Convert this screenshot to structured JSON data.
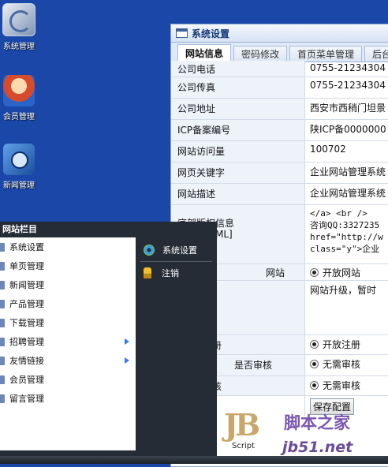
{
  "desktop": {
    "icons": [
      {
        "label": "系统管理"
      },
      {
        "label": "会员管理"
      },
      {
        "label": "新闻管理"
      }
    ]
  },
  "window": {
    "title": "系统设置",
    "tabs": [
      "网站信息",
      "密码修改",
      "首页菜单管理",
      "后台"
    ],
    "fields": [
      {
        "label": "公司电话",
        "value": "0755-21234304"
      },
      {
        "label": "公司传真",
        "value": "0755-21234304"
      },
      {
        "label": "公司地址",
        "value": "西安市西稍门坦景"
      },
      {
        "label": "ICP备案编号",
        "value": "陕ICP备0000000"
      },
      {
        "label": "网站访问量",
        "value": "100702"
      },
      {
        "label": "网页关键字",
        "value": "企业网站管理系统"
      },
      {
        "label": "网站描述",
        "value": "企业网站管理系统"
      }
    ],
    "copyright": {
      "label_line1": "底部版权信息",
      "label_line2": "ML]",
      "lines": [
        "</a>   <br />",
        "咨询QQ:3327235",
        "href=\"http://w",
        "class=\"y\">企业"
      ]
    },
    "site_toggle": {
      "label": "网站",
      "option": "开放网站"
    },
    "notice": {
      "text": "网站升级，暂时"
    },
    "register": {
      "label": "注册",
      "option": "开放注册"
    },
    "review1": {
      "label": "是否审核",
      "option": "无需审核"
    },
    "review2": {
      "label": "审核",
      "option": "无需审核"
    },
    "save_label": "保存配置"
  },
  "start_menu": {
    "title": "网站栏目",
    "items": [
      {
        "label": "系统设置"
      },
      {
        "label": "单页管理"
      },
      {
        "label": "新闻管理"
      },
      {
        "label": "产品管理"
      },
      {
        "label": "下载管理"
      },
      {
        "label": "招聘管理"
      },
      {
        "label": "友情链接"
      },
      {
        "label": "会员管理"
      },
      {
        "label": "留言管理"
      }
    ],
    "right_items": [
      {
        "label": "系统设置",
        "icon": "gear-icon"
      },
      {
        "label": "注销",
        "icon": "key-icon"
      }
    ]
  },
  "watermark": {
    "logo": "JB",
    "script": "Script",
    "site_name": "脚本之家",
    "url": "jb51.net"
  }
}
